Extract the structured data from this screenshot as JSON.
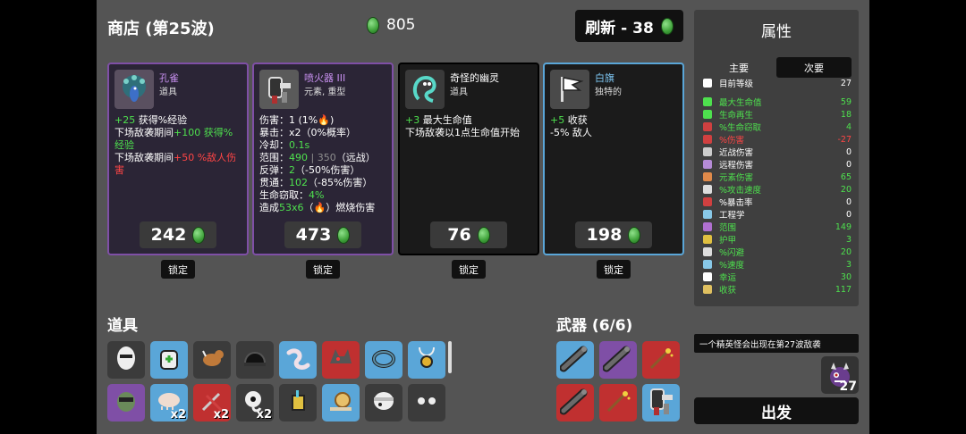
{
  "shop": {
    "title": "商店 (第25波)",
    "gold": "805",
    "reroll_label": "刷新 - 38"
  },
  "colors": {
    "tier_epic": "#7f4fa6",
    "tier_rare": "#5aa6d8",
    "tier_legendary": "#c03030",
    "tier_common": "#3b3b3b",
    "positive": "#4ee04e",
    "negative": "#ff4545"
  },
  "cards": [
    {
      "name": "孔雀",
      "type": "道具",
      "icon": "peacock-icon",
      "price": "242",
      "lock": "锁定",
      "lines": [
        [
          {
            "t": "+25",
            "c": "g"
          },
          {
            "t": " 获得%经验"
          }
        ],
        [
          {
            "t": "下场敌袭期间"
          },
          {
            "t": "+100 获得%经验",
            "c": "g"
          }
        ],
        [
          {
            "t": "下场敌袭期间"
          },
          {
            "t": "+50 %敌人伤害",
            "c": "r"
          }
        ]
      ]
    },
    {
      "name": "喷火器 III",
      "type": "元素, 重型",
      "icon": "flamethrower-icon",
      "price": "473",
      "lock": "锁定",
      "lines": [
        [
          {
            "t": "伤害：1 (1%"
          },
          {
            "t": "🔥"
          },
          {
            "t": ")"
          }
        ],
        [
          {
            "t": "暴击：x2（0%概率）"
          }
        ],
        [
          {
            "t": "冷却："
          },
          {
            "t": "0.1s",
            "c": "g"
          }
        ],
        [
          {
            "t": "范围："
          },
          {
            "t": "490",
            "c": "g"
          },
          {
            "t": " | 350",
            "c": "gy"
          },
          {
            "t": "（远战）"
          }
        ],
        [
          {
            "t": "反弹："
          },
          {
            "t": "2",
            "c": "g"
          },
          {
            "t": "（-50%伤害）"
          }
        ],
        [
          {
            "t": "贯通："
          },
          {
            "t": "102",
            "c": "g"
          },
          {
            "t": "（-85%伤害）"
          }
        ],
        [
          {
            "t": "生命窃取："
          },
          {
            "t": "4%",
            "c": "g"
          }
        ],
        [
          {
            "t": "造成"
          },
          {
            "t": "53x6",
            "c": "g"
          },
          {
            "t": "（🔥）燃烧伤害"
          }
        ]
      ]
    },
    {
      "name": "奇怪的幽灵",
      "type": "道具",
      "icon": "ghost-icon",
      "price": "76",
      "lock": "锁定",
      "lines": [
        [
          {
            "t": "+3",
            "c": "g"
          },
          {
            "t": " 最大生命值"
          }
        ],
        [
          {
            "t": "下场敌袭以1点生命值开始"
          }
        ]
      ]
    },
    {
      "name": "白旗",
      "type": "独特的",
      "icon": "white-flag-icon",
      "price": "198",
      "lock": "锁定",
      "lines": [
        [
          {
            "t": "+5",
            "c": "g"
          },
          {
            "t": " 收获"
          }
        ],
        [
          {
            "t": "-5% 敌人"
          }
        ]
      ]
    }
  ],
  "items_title": "道具",
  "items": [
    {
      "icon": "mask-icon",
      "tier": "common",
      "count": ""
    },
    {
      "icon": "backpack-icon",
      "tier": "rare",
      "count": ""
    },
    {
      "icon": "dog-icon",
      "tier": "common",
      "count": ""
    },
    {
      "icon": "helmet-icon",
      "tier": "common",
      "count": ""
    },
    {
      "icon": "worm-icon",
      "tier": "rare",
      "count": ""
    },
    {
      "icon": "wolf-icon",
      "tier": "legendary",
      "count": ""
    },
    {
      "icon": "ring-icon",
      "tier": "rare",
      "count": ""
    },
    {
      "icon": "amulet-icon",
      "tier": "rare",
      "count": ""
    },
    {
      "icon": "alien-icon",
      "tier": "epic",
      "count": ""
    },
    {
      "icon": "tardigrade-icon",
      "tier": "rare",
      "count": "x2"
    },
    {
      "icon": "tools-icon",
      "tier": "legendary",
      "count": "x2"
    },
    {
      "icon": "ghost-eye-icon",
      "tier": "common",
      "count": "x2"
    },
    {
      "icon": "juice-icon",
      "tier": "common",
      "count": ""
    },
    {
      "icon": "snail-icon",
      "tier": "rare",
      "count": ""
    },
    {
      "icon": "bandage-icon",
      "tier": "common",
      "count": ""
    },
    {
      "icon": "eyes-icon",
      "tier": "common",
      "count": ""
    }
  ],
  "weapons_title": "武器 (6/6)",
  "weapons": [
    {
      "icon": "minigun-icon",
      "tier": "rare"
    },
    {
      "icon": "minigun-icon",
      "tier": "epic"
    },
    {
      "icon": "wand-icon",
      "tier": "legendary"
    },
    {
      "icon": "minigun-icon",
      "tier": "legendary"
    },
    {
      "icon": "wand-icon",
      "tier": "legendary"
    },
    {
      "icon": "flamethrower-icon",
      "tier": "rare"
    }
  ],
  "attributes": {
    "title": "属性",
    "tab_primary": "主要",
    "tab_secondary": "次要",
    "stats": [
      {
        "label": "目前等级",
        "value": "27",
        "color": "#ffffff",
        "vcolor": "#ffffff",
        "icon": "level-icon",
        "ic": "#ffffff"
      },
      {
        "label": "最大生命值",
        "value": "59",
        "color": "#4ee04e",
        "vcolor": "#4ee04e",
        "icon": "heart-icon",
        "ic": "#4ee04e"
      },
      {
        "label": "生命再生",
        "value": "18",
        "color": "#4ee04e",
        "vcolor": "#4ee04e",
        "icon": "regen-icon",
        "ic": "#4ee04e"
      },
      {
        "label": "%生命窃取",
        "value": "4",
        "color": "#4ee04e",
        "vcolor": "#4ee04e",
        "icon": "lifesteal-icon",
        "ic": "#d04040"
      },
      {
        "label": "%伤害",
        "value": "-27",
        "color": "#ff4545",
        "vcolor": "#ff4545",
        "icon": "damage-icon",
        "ic": "#d04040"
      },
      {
        "label": "近战伤害",
        "value": "0",
        "color": "#ffffff",
        "vcolor": "#ffffff",
        "icon": "melee-icon",
        "ic": "#cccccc"
      },
      {
        "label": "远程伤害",
        "value": "0",
        "color": "#ffffff",
        "vcolor": "#ffffff",
        "icon": "ranged-icon",
        "ic": "#b58bd6"
      },
      {
        "label": "元素伤害",
        "value": "65",
        "color": "#4ee04e",
        "vcolor": "#4ee04e",
        "icon": "fire-icon",
        "ic": "#e08a4a"
      },
      {
        "label": "%攻击速度",
        "value": "20",
        "color": "#4ee04e",
        "vcolor": "#4ee04e",
        "icon": "hourglass-icon",
        "ic": "#dddddd"
      },
      {
        "label": "%暴击率",
        "value": "0",
        "color": "#ffffff",
        "vcolor": "#ffffff",
        "icon": "crit-icon",
        "ic": "#d04040"
      },
      {
        "label": "工程学",
        "value": "0",
        "color": "#ffffff",
        "vcolor": "#ffffff",
        "icon": "wrench-icon",
        "ic": "#88c8e8"
      },
      {
        "label": "范围",
        "value": "149",
        "color": "#4ee04e",
        "vcolor": "#4ee04e",
        "icon": "range-icon",
        "ic": "#b070d0"
      },
      {
        "label": "护甲",
        "value": "3",
        "color": "#4ee04e",
        "vcolor": "#4ee04e",
        "icon": "armor-icon",
        "ic": "#e0c040"
      },
      {
        "label": "%闪避",
        "value": "20",
        "color": "#4ee04e",
        "vcolor": "#4ee04e",
        "icon": "dodge-icon",
        "ic": "#dddddd"
      },
      {
        "label": "%速度",
        "value": "3",
        "color": "#4ee04e",
        "vcolor": "#4ee04e",
        "icon": "speed-icon",
        "ic": "#88c8e8"
      },
      {
        "label": "幸运",
        "value": "30",
        "color": "#4ee04e",
        "vcolor": "#4ee04e",
        "icon": "luck-icon",
        "ic": "#ffffff"
      },
      {
        "label": "收获",
        "value": "117",
        "color": "#4ee04e",
        "vcolor": "#4ee04e",
        "icon": "harvest-icon",
        "ic": "#e0c060"
      }
    ]
  },
  "notice": "一个精英怪会出现在第27波敌袭",
  "elite_count": "27",
  "go_label": "出发"
}
